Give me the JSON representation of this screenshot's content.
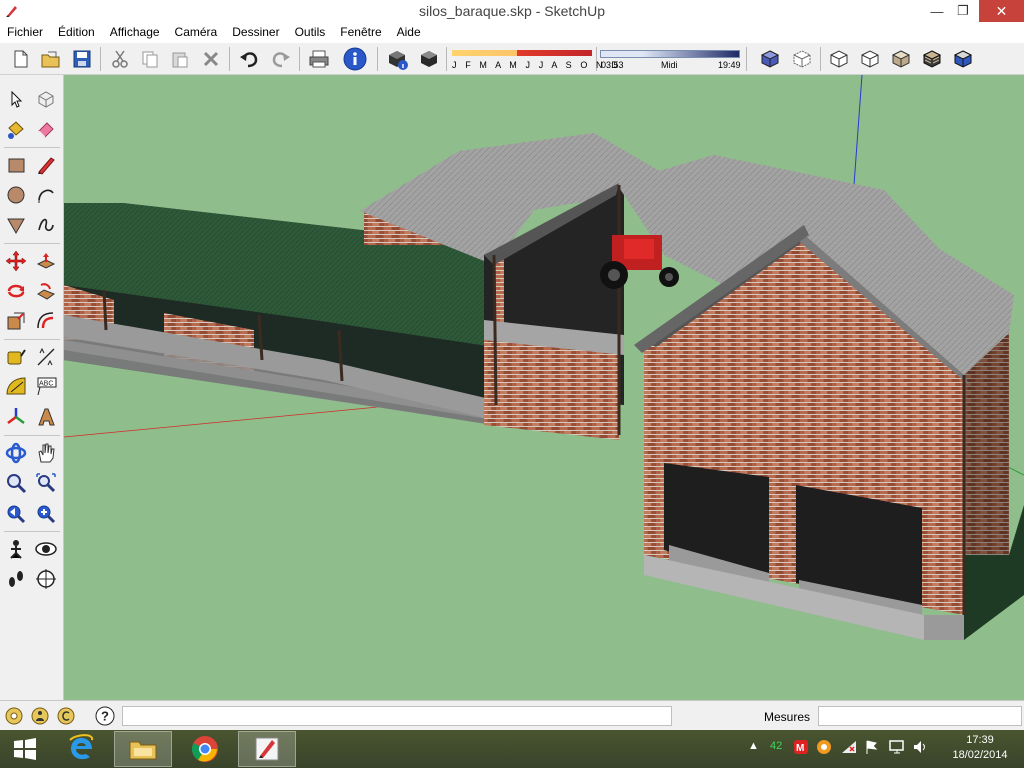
{
  "window": {
    "title": "silos_baraque.skp - SketchUp",
    "min_glyph": "—",
    "max_glyph": "❐",
    "close_glyph": "✕"
  },
  "menu": [
    "Fichier",
    "Édition",
    "Affichage",
    "Caméra",
    "Dessiner",
    "Outils",
    "Fenêtre",
    "Aide"
  ],
  "shadow": {
    "months": "J F M A M J J A S O N D",
    "time_start": "03:53",
    "time_mid": "Midi",
    "time_end": "19:49"
  },
  "toolbar_icons": [
    "new-file-icon",
    "open-folder-icon",
    "save-icon",
    "cut-icon",
    "copy-icon",
    "paste-icon",
    "delete-icon",
    "undo-icon",
    "redo-icon",
    "print-icon",
    "model-info-icon",
    "shadow-settings-icon",
    "shadow-toggle-icon",
    "iso-view-icon",
    "top-view-icon",
    "front-view-icon",
    "right-view-icon",
    "back-view-icon",
    "left-view-icon",
    "xray-style-icon",
    "wireframe-style-icon",
    "hidden-line-style-icon",
    "shaded-style-icon",
    "textured-style-icon",
    "monochrome-style-icon"
  ],
  "palette_icons": [
    "select-icon",
    "make-component-icon",
    "paint-bucket-icon",
    "eraser-icon",
    "rectangle-icon",
    "line-pencil-icon",
    "circle-icon",
    "arc-icon",
    "polygon-icon",
    "freehand-icon",
    "move-icon",
    "push-pull-icon",
    "rotate-icon",
    "follow-me-icon",
    "scale-icon",
    "offset-icon",
    "tape-measure-icon",
    "dimension-icon",
    "protractor-icon",
    "text-icon",
    "axes-icon",
    "3d-text-icon",
    "orbit-icon",
    "pan-icon",
    "zoom-icon",
    "zoom-window-icon",
    "previous-view-icon",
    "zoom-extents-icon",
    "position-camera-icon",
    "look-around-icon",
    "walk-icon",
    "section-plane-icon"
  ],
  "statusbar": {
    "measurements_label": "Mesures",
    "measurements_value": ""
  },
  "taskbar": {
    "apps": [
      "start-icon",
      "internet-explorer-icon",
      "file-explorer-icon",
      "chrome-icon",
      "sketchup-icon"
    ],
    "tray_count": "42",
    "time": "17:39",
    "date": "18/02/2014"
  },
  "colors": {
    "viewport_bg": "#8fbd8c",
    "brick": "#a65a42",
    "roof": "#9c9c9c",
    "green_roof": "#2f5a3a",
    "taskbar": "#3e4a1f"
  }
}
